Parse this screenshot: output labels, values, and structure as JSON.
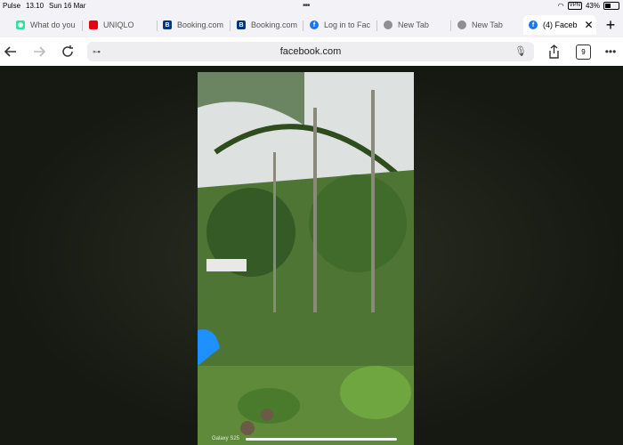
{
  "status": {
    "app": "Pulse",
    "time": "13.10",
    "date": "Sun 16 Mar",
    "vpn": "VPN",
    "battery": "43%"
  },
  "tabs": [
    {
      "label": "What do you",
      "icon": "tripadvisor-icon",
      "color": "#34e0a1"
    },
    {
      "label": "UNIQLO",
      "icon": "uniqlo-icon",
      "color": "#e60012"
    },
    {
      "label": "Booking.com",
      "icon": "booking-icon",
      "color": "#003580"
    },
    {
      "label": "Booking.com",
      "icon": "booking-icon",
      "color": "#003580"
    },
    {
      "label": "Log in to Fac",
      "icon": "facebook-icon",
      "color": "#1877f2"
    },
    {
      "label": "New Tab",
      "icon": "globe-icon",
      "color": "#8e8e93"
    },
    {
      "label": "New Tab",
      "icon": "globe-icon",
      "color": "#8e8e93"
    },
    {
      "label": "(4) Faceb",
      "icon": "facebook-icon",
      "color": "#1877f2"
    }
  ],
  "toolbar": {
    "url": "facebook.com",
    "tab_count": "9"
  },
  "content": {
    "watermark": "Galaxy S25"
  }
}
